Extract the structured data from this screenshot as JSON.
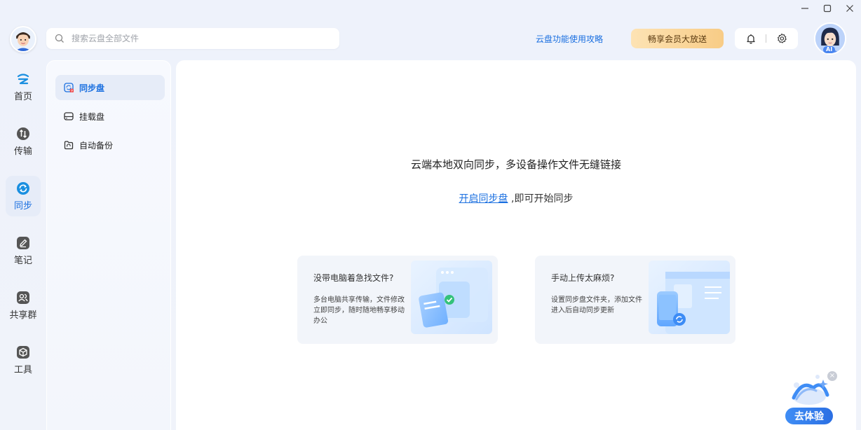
{
  "window": {
    "controls": [
      "minimize",
      "maximize",
      "close"
    ]
  },
  "nav": {
    "items": [
      {
        "label": "首页",
        "icon": "cloud-home-icon"
      },
      {
        "label": "传输",
        "icon": "transfer-icon"
      },
      {
        "label": "同步",
        "icon": "sync-icon",
        "active": true
      },
      {
        "label": "笔记",
        "icon": "note-icon"
      },
      {
        "label": "共享群",
        "icon": "share-group-icon"
      },
      {
        "label": "工具",
        "icon": "tools-icon"
      }
    ]
  },
  "search": {
    "placeholder": "搜索云盘全部文件"
  },
  "header": {
    "guide_link": "云盘功能使用攻略",
    "vip_button": "畅享会员大放送",
    "ai_badge": "AI"
  },
  "sidebar": {
    "items": [
      {
        "label": "同步盘",
        "active": true
      },
      {
        "label": "挂载盘"
      },
      {
        "label": "自动备份"
      }
    ]
  },
  "main": {
    "headline": "云端本地双向同步，多设备操作文件无缝链接",
    "open_link": "开启同步盘",
    "open_suffix": " ,即可开始同步",
    "cards": [
      {
        "title": "没带电脑着急找文件?",
        "desc": "多台电脑共享传输，文件修改立即同步，随时随地畅享移动办公"
      },
      {
        "title": "手动上传太麻烦?",
        "desc": "设置同步盘文件夹，添加文件进入后自动同步更新"
      }
    ]
  },
  "widget": {
    "try_label": "去体验",
    "close_label": "×"
  },
  "colors": {
    "accent": "#1a6fe0",
    "vip_gold": "#f8cc86"
  }
}
